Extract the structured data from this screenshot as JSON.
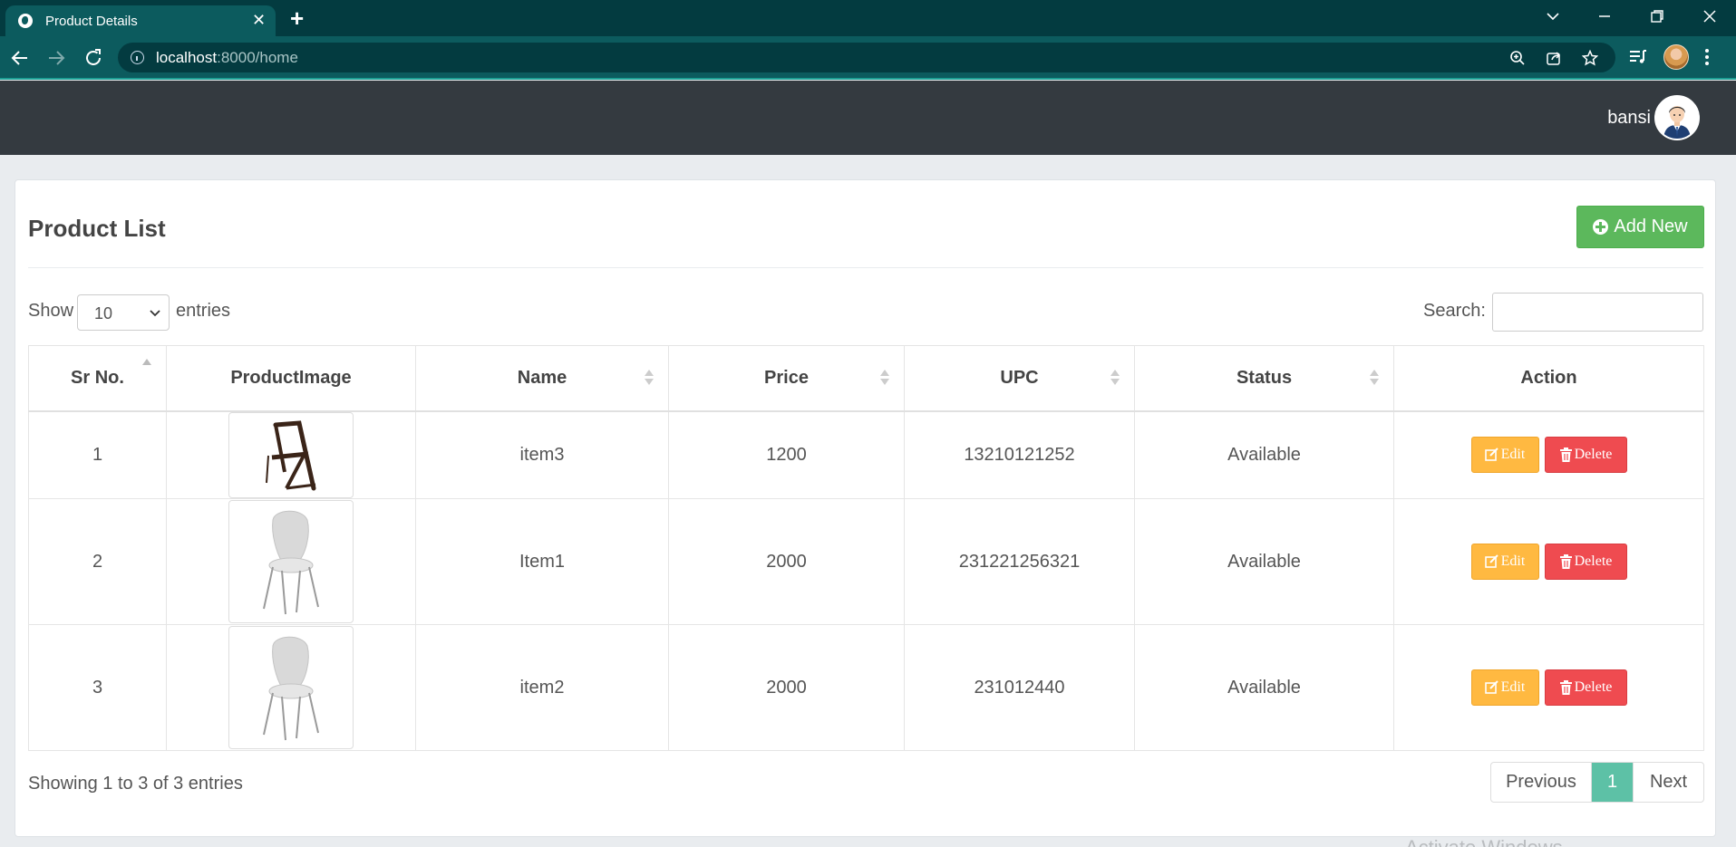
{
  "browser": {
    "tab_title": "Product Details",
    "url_host": "localhost",
    "url_rest": ":8000/home",
    "icons": [
      "globe-icon",
      "close-icon",
      "plus-icon",
      "chevron-down-icon",
      "minimize-icon",
      "restore-icon",
      "close-window-icon",
      "back-arrow-icon",
      "forward-arrow-icon",
      "reload-icon",
      "info-icon",
      "zoom-icon",
      "share-icon",
      "star-icon",
      "reading-list-icon",
      "menu-icon"
    ]
  },
  "header": {
    "user_name": "bansi"
  },
  "card": {
    "title": "Product List",
    "add_button": "Add New"
  },
  "controls": {
    "show_label": "Show",
    "page_length": "10",
    "entries_label": "entries",
    "search_label": "Search:",
    "search_value": ""
  },
  "table": {
    "headers": [
      "Sr No.",
      "ProductImage",
      "Name",
      "Price",
      "UPC",
      "Status",
      "Action"
    ],
    "rows": [
      {
        "sr": "1",
        "image": "folding-chair",
        "name": "item3",
        "price": "1200",
        "upc": "13210121252",
        "status": "Available"
      },
      {
        "sr": "2",
        "image": "white-chair",
        "name": "Item1",
        "price": "2000",
        "upc": "231221256321",
        "status": "Available"
      },
      {
        "sr": "3",
        "image": "white-chair",
        "name": "item2",
        "price": "2000",
        "upc": "231012440",
        "status": "Available"
      }
    ],
    "edit_label": "Edit",
    "delete_label": "Delete"
  },
  "footer": {
    "info": "Showing 1 to 3 of 3 entries",
    "previous": "Previous",
    "page": "1",
    "next": "Next"
  },
  "watermark": "Activate Windows",
  "colors": {
    "header_bg": "#343a40",
    "add_button": "#5cb85c",
    "edit_button": "#ffb941",
    "delete_button": "#ef4b50",
    "active_page": "#5dc1a6",
    "browser_frame": "#0c5b5e"
  }
}
